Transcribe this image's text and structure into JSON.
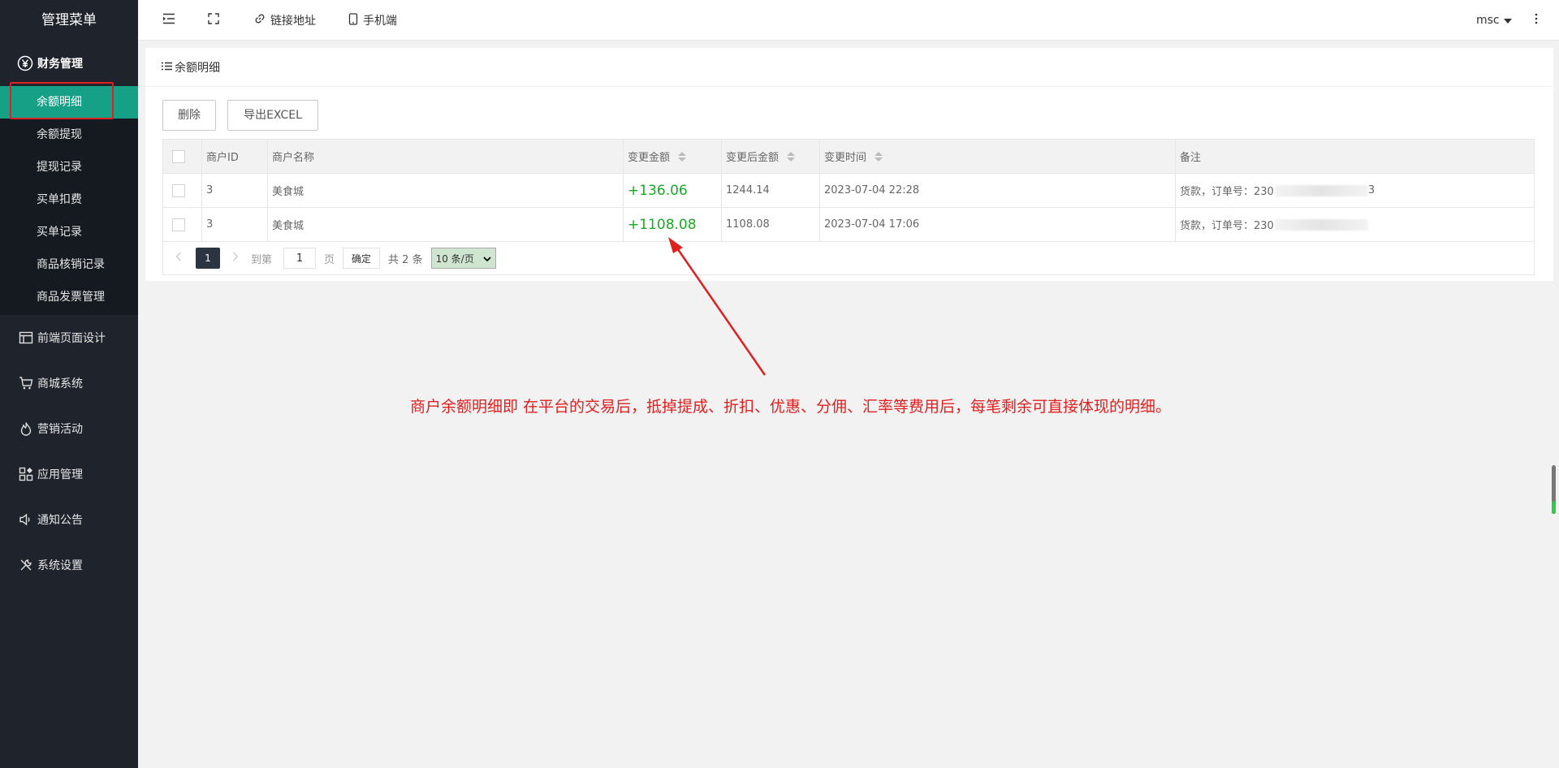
{
  "sidebar": {
    "title": "管理菜单",
    "group": {
      "label": "财务管理",
      "icon": "yen-circle-icon"
    },
    "sub_items": [
      "余额明细",
      "余额提现",
      "提现记录",
      "买单扣费",
      "买单记录",
      "商品核销记录",
      "商品发票管理"
    ],
    "nav": [
      {
        "label": "前端页面设计",
        "icon": "layout-icon"
      },
      {
        "label": "商城系统",
        "icon": "cart-icon"
      },
      {
        "label": "营销活动",
        "icon": "fire-icon"
      },
      {
        "label": "应用管理",
        "icon": "apps-icon"
      },
      {
        "label": "通知公告",
        "icon": "speaker-icon"
      },
      {
        "label": "系统设置",
        "icon": "tools-icon"
      }
    ]
  },
  "topbar": {
    "link_label": "链接地址",
    "mobile_label": "手机端",
    "user": "msc"
  },
  "panel": {
    "title": "余额明细",
    "delete_label": "删除",
    "export_label": "导出EXCEL",
    "columns": [
      "商户ID",
      "商户名称",
      "变更金额",
      "变更后金额",
      "变更时间",
      "备注"
    ],
    "rows": [
      {
        "id": "3",
        "name": "美食城",
        "change": "+136.06",
        "after": "1244.14",
        "time": "2023-07-04 22:28",
        "note": "货款，订单号：230",
        "note_tail": "3"
      },
      {
        "id": "3",
        "name": "美食城",
        "change": "+1108.08",
        "after": "1108.08",
        "time": "2023-07-04 17:06",
        "note": "货款，订单号：230",
        "note_tail": ""
      }
    ]
  },
  "pager": {
    "current": "1",
    "goto_label": "到第",
    "page_input": "1",
    "page_unit": "页",
    "confirm_label": "确定",
    "total": "共 2 条",
    "per_page": "10 条/页"
  },
  "annotation": "商户余额明细即 在平台的交易后，抵掉提成、折扣、优惠、分佣、汇率等费用后，每笔剩余可直接体现的明细。",
  "colors": {
    "sidebar_bg": "#1f232b",
    "active": "#16a085",
    "positive": "#19a826",
    "annotation": "#e02020"
  }
}
